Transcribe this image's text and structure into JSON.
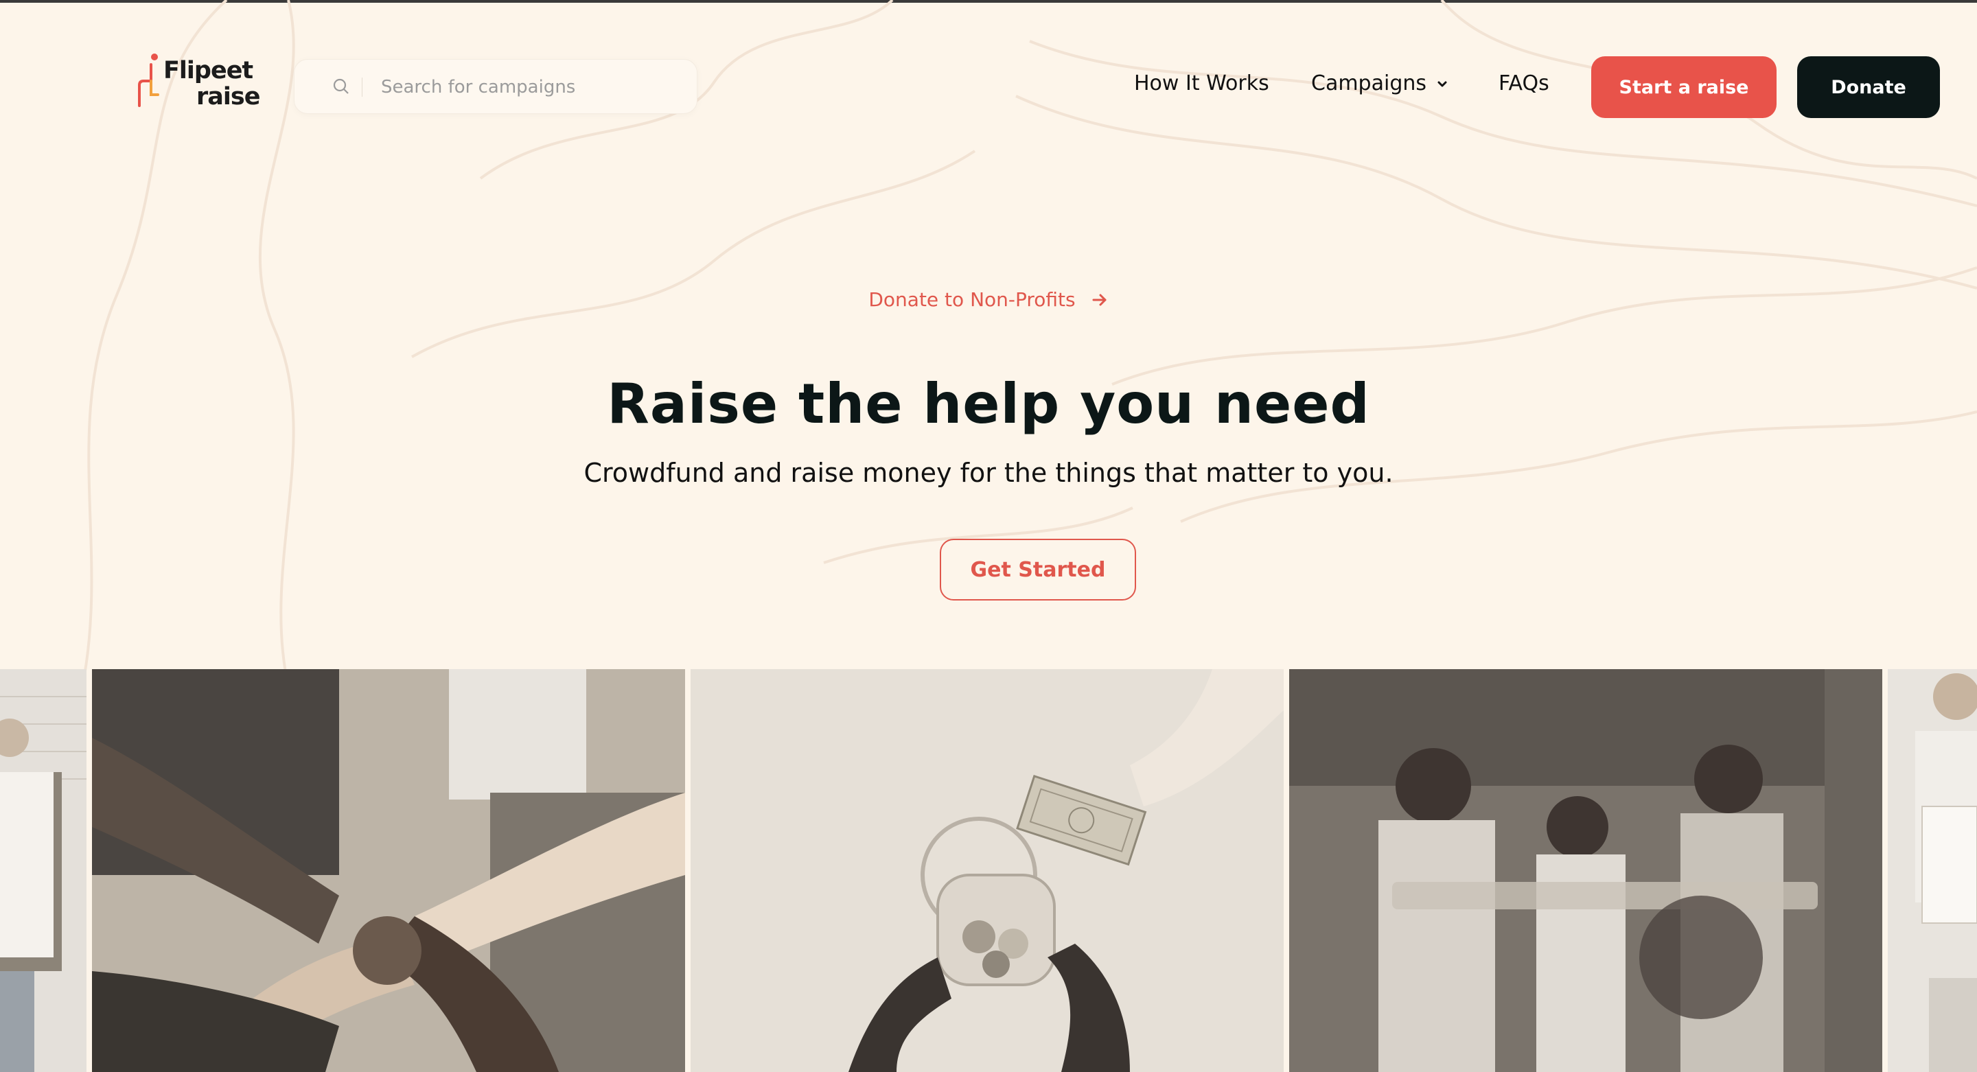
{
  "header": {
    "logo": {
      "line1": "Flipeet",
      "line2": "raise"
    },
    "search": {
      "placeholder": "Search for campaigns",
      "value": ""
    },
    "nav": [
      {
        "label": "How It Works"
      },
      {
        "label": "Campaigns",
        "icon": "chevron-down-icon"
      },
      {
        "label": "FAQs"
      }
    ],
    "start_raise_label": "Start a raise",
    "donate_label": "Donate"
  },
  "hero": {
    "eyebrow": "Donate to Non-Profits",
    "title": "Raise the help you need",
    "subtitle": "Crowdfund and raise money for the things that matter to you.",
    "cta": "Get Started"
  },
  "gallery": [
    {
      "subject": "woman holding sign"
    },
    {
      "subject": "hands holding wrists in a circle"
    },
    {
      "subject": "hands putting money into a jar"
    },
    {
      "subject": "smiling volunteers"
    },
    {
      "subject": "man holding sign"
    }
  ],
  "colors": {
    "background": "#fdf5ea",
    "accent": "#e8534a",
    "dark": "#0c1717"
  }
}
